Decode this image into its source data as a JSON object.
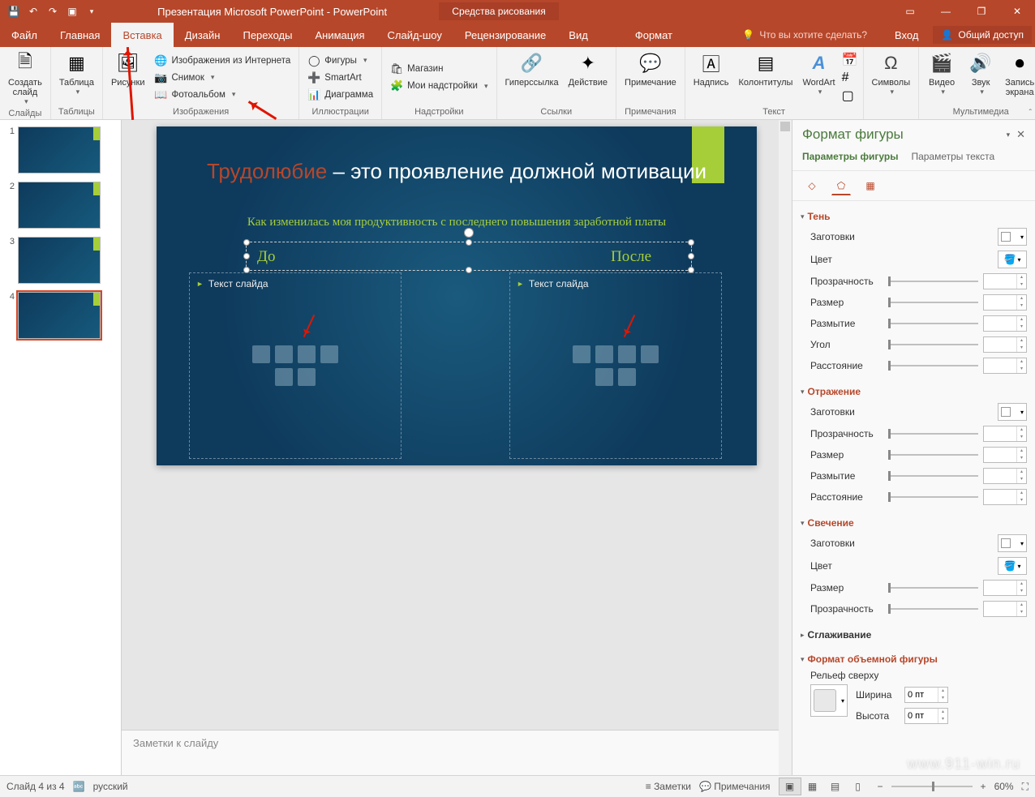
{
  "titlebar": {
    "title": "Презентация Microsoft PowerPoint - PowerPoint",
    "drawing_tools": "Средства рисования"
  },
  "tabs": {
    "file": "Файл",
    "home": "Главная",
    "insert": "Вставка",
    "design": "Дизайн",
    "transitions": "Переходы",
    "animations": "Анимация",
    "slideshow": "Слайд-шоу",
    "review": "Рецензирование",
    "view": "Вид",
    "format": "Формат",
    "tellme": "Что вы хотите сделать?",
    "signin": "Вход",
    "share": "Общий доступ"
  },
  "ribbon": {
    "groups": {
      "slides": {
        "label": "Слайды",
        "new_slide": "Создать\nслайд"
      },
      "tables": {
        "label": "Таблицы",
        "table": "Таблица"
      },
      "images": {
        "label": "Изображения",
        "pictures": "Рисунки",
        "online": "Изображения из Интернета",
        "screenshot": "Снимок",
        "album": "Фотоальбом"
      },
      "illustrations": {
        "label": "Иллюстрации",
        "shapes": "Фигуры",
        "smartart": "SmartArt",
        "chart": "Диаграмма"
      },
      "addins": {
        "label": "Надстройки",
        "store": "Магазин",
        "myaddins": "Мои надстройки"
      },
      "links": {
        "label": "Ссылки",
        "hyperlink": "Гиперссылка",
        "action": "Действие"
      },
      "comments": {
        "label": "Примечания",
        "comment": "Примечание"
      },
      "text": {
        "label": "Текст",
        "textbox": "Надпись",
        "headerfooter": "Колонтитулы",
        "wordart": "WordArt"
      },
      "symbols": {
        "label": "",
        "symbols": "Символы"
      },
      "media": {
        "label": "Мультимедиа",
        "video": "Видео",
        "audio": "Звук",
        "screenrec": "Запись\nэкрана"
      }
    }
  },
  "slide": {
    "title_red": "Трудолюбие",
    "title_rest": " – это проявление должной мотивации",
    "subtitle": "Как изменилась моя продуктивность с последнего повышения заработной платы",
    "before": "До",
    "after": "После",
    "placeholder": "Текст слайда"
  },
  "thumbs": [
    "1",
    "2",
    "3",
    "4"
  ],
  "notes": "Заметки к слайду",
  "pane": {
    "title": "Формат фигуры",
    "tab_shape": "Параметры фигуры",
    "tab_text": "Параметры текста",
    "sections": {
      "shadow": "Тень",
      "reflection": "Отражение",
      "glow": "Свечение",
      "soft": "Сглаживание",
      "format3d": "Формат объемной фигуры",
      "relief": "Рельеф сверху"
    },
    "props": {
      "presets": "Заготовки",
      "color": "Цвет",
      "transparency": "Прозрачность",
      "size": "Размер",
      "blur": "Размытие",
      "angle": "Угол",
      "distance": "Расстояние",
      "width": "Ширина",
      "height": "Высота",
      "zero": "0 пт"
    }
  },
  "status": {
    "slide": "Слайд 4 из 4",
    "lang": "русский",
    "notes": "Заметки",
    "comments": "Примечания",
    "zoom": "60%"
  },
  "watermark": "www.911-win.ru"
}
